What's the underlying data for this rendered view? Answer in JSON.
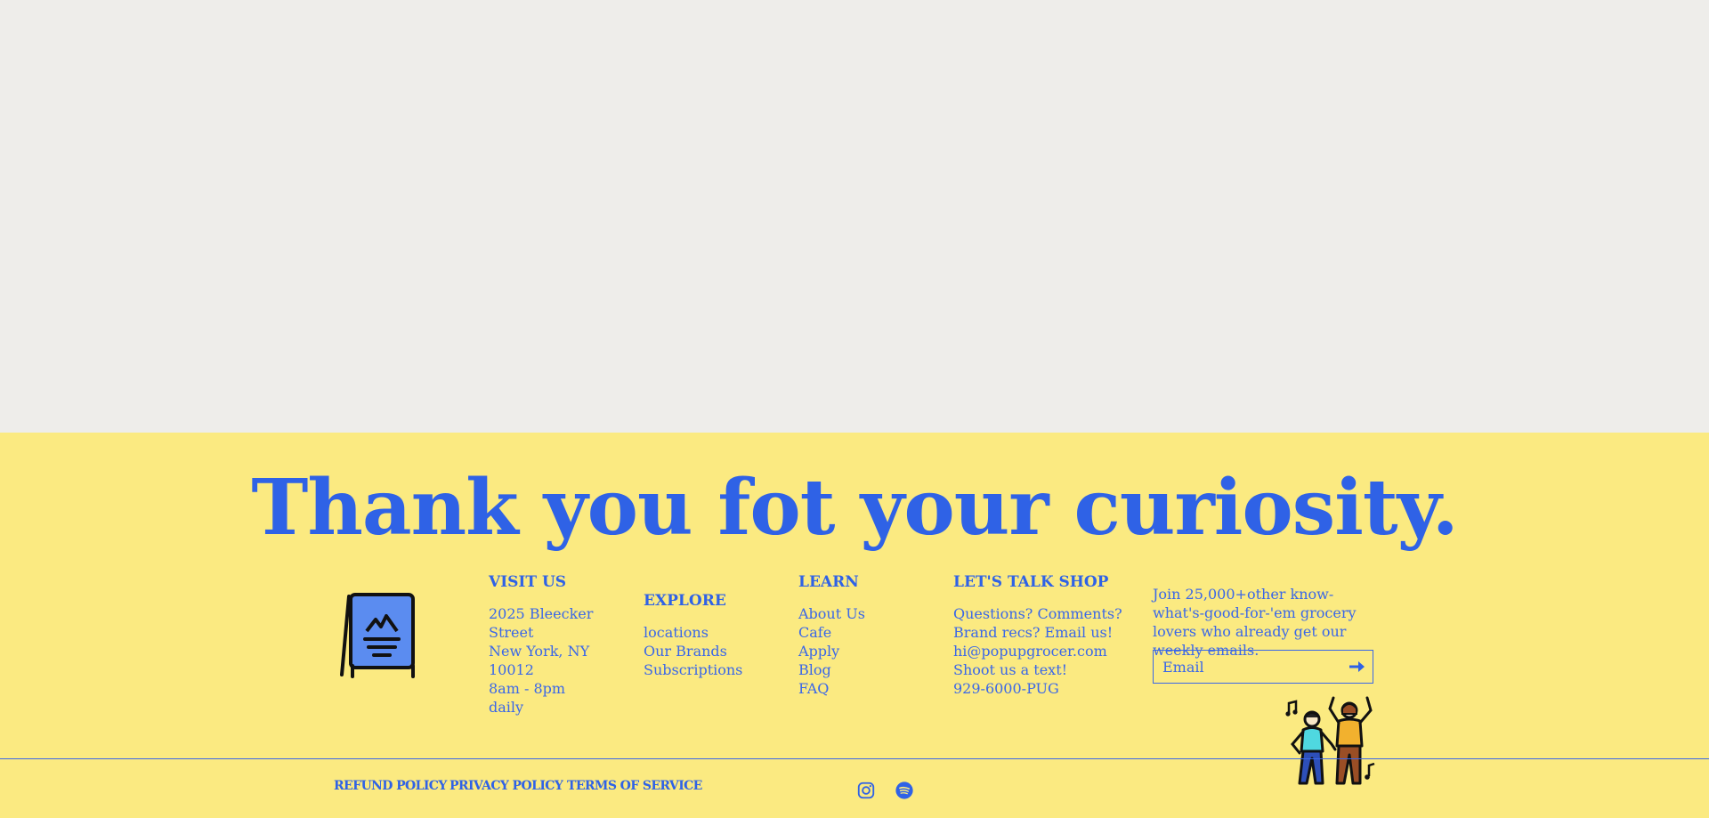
{
  "footer": {
    "headline": "Thank you fot your curiosity.",
    "visit": {
      "heading": "VISIT US",
      "street": "2025 Bleecker Street",
      "city": "New York, NY 10012",
      "hours": "8am - 8pm daily"
    },
    "explore": {
      "heading": "EXPLORE",
      "links": [
        "locations",
        "Our Brands",
        "Subscriptions"
      ]
    },
    "learn": {
      "heading": "LEARN",
      "links": [
        "About Us",
        "Cafe",
        "Apply",
        "Blog",
        "FAQ"
      ]
    },
    "talk": {
      "heading": "LET'S TALK SHOP",
      "lines": [
        "Questions? Comments?",
        "Brand recs? Email us!",
        "hi@popupgrocer.com",
        "Shoot us a text!",
        "929-6000-PUG"
      ]
    },
    "newsletter": {
      "text": "Join 25,000+other know-what's-good-for-'em grocery lovers who already get our weekly emails.",
      "email_placeholder": "Email"
    },
    "legal": {
      "refund": "REFUND POLICY",
      "privacy": "PRIVACY POLICY",
      "terms": "TERMS OF SERVICE"
    },
    "social": [
      "instagram-icon",
      "spotify-icon"
    ]
  },
  "colors": {
    "background_top": "#EEEDEA",
    "footer_bg": "#FBEA81",
    "accent_blue": "#2F62E6"
  }
}
